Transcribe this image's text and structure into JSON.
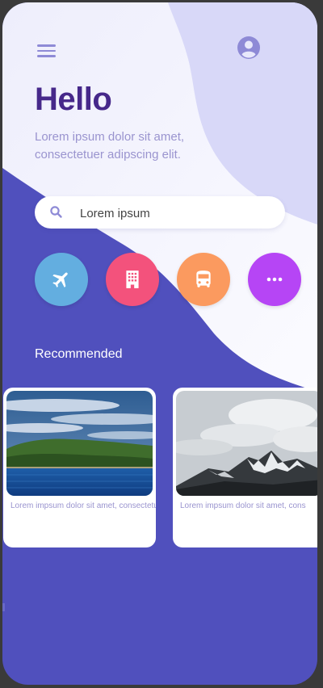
{
  "header": {
    "menu_icon": "hamburger-menu-icon",
    "account_icon": "account-circle-icon",
    "title": "Hello",
    "subtitle": "Lorem ipsum dolor sit amet, consectetuer adipscing elit."
  },
  "search": {
    "icon": "search-icon",
    "placeholder": "Lorem ipsum"
  },
  "categories": [
    {
      "icon": "airplane-icon",
      "color": "#63aee0"
    },
    {
      "icon": "building-icon",
      "color": "#f3527c"
    },
    {
      "icon": "bus-icon",
      "color": "#fb9a5f"
    },
    {
      "icon": "more-dots-icon",
      "color": "#b645f5"
    }
  ],
  "recommended": {
    "title": "Recommended",
    "cards": [
      {
        "image": "lake-island-photo",
        "caption": "Lorem impsum dolor sit amet, consectetuer"
      },
      {
        "image": "snowy-mountain-photo",
        "caption": "Lorem impsum dolor sit amet, cons"
      }
    ]
  },
  "colors": {
    "primary": "#5050bd",
    "title": "#46288a",
    "subtitle": "#9a94cf",
    "light_bg": "#f3f2fc"
  }
}
